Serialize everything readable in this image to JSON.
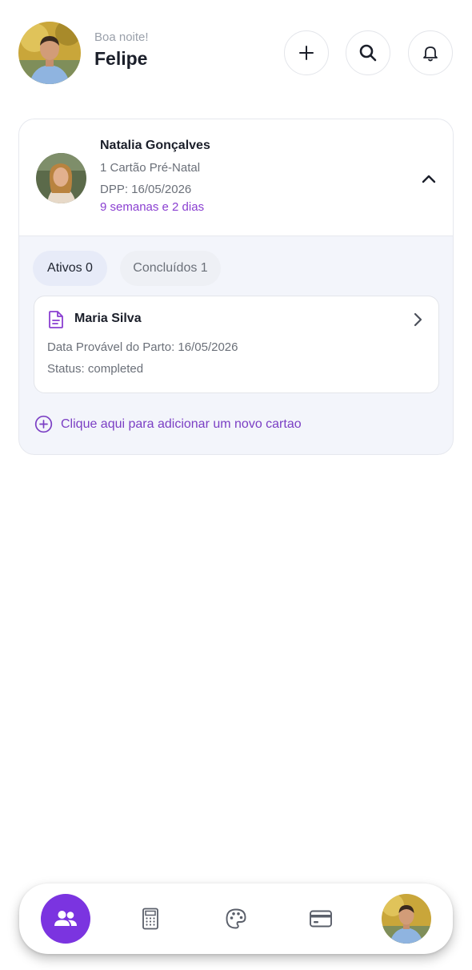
{
  "header": {
    "greeting": "Boa noite!",
    "user_name": "Felipe",
    "actions": [
      "plus-icon",
      "search-icon",
      "bell-icon"
    ]
  },
  "patient": {
    "name": "Natalia Gonçalves",
    "cards_count": "1 Cartão Pré-Natal",
    "dpp": "DPP: 16/05/2026",
    "gestational_age": "9 semanas e 2 dias",
    "tabs": [
      {
        "label": "Ativos 0",
        "active": true
      },
      {
        "label": "Concluídos 1",
        "active": false
      }
    ],
    "item": {
      "title": "Maria Silva",
      "due_date": "Data Provável do Parto: 16/05/2026",
      "status": "Status: completed"
    },
    "add_card_label": "Clique aqui para adicionar um novo cartao"
  },
  "bottom_nav": {
    "items": [
      "users-icon",
      "calculator-icon",
      "palette-icon",
      "credit-card-icon",
      "profile-avatar"
    ],
    "active_index": 0
  },
  "colors": {
    "accent": "#7b34e0",
    "accent_text": "#8a3fd1",
    "card_bg": "#f3f5fb"
  }
}
